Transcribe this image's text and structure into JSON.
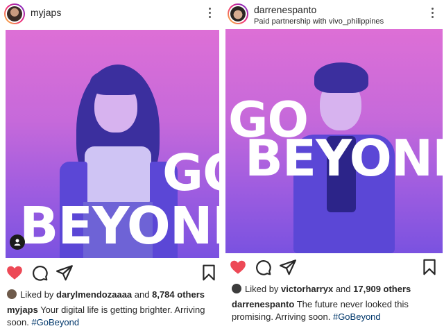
{
  "left_post": {
    "username": "myjaps",
    "image_text": {
      "go": "GO",
      "beyond": "BEYOND"
    },
    "likes": {
      "prefix": "Liked by",
      "user": "darylmendozaaaa",
      "middle": "and",
      "count": "8,784 others"
    },
    "caption": {
      "user": "myjaps",
      "text": "Your digital life is getting brighter. Arriving soon.",
      "hashtag": "#GoBeyond"
    }
  },
  "right_post": {
    "username": "darrenespanto",
    "sponsor": "Paid partnership with vivo_philippines",
    "image_text": {
      "go": "GO",
      "beyond": "BEYOND"
    },
    "likes": {
      "prefix": "Liked by",
      "user": "victorharryx",
      "middle": "and",
      "count": "17,909 others"
    },
    "caption": {
      "user": "darrenespanto",
      "text": "The future never looked this promising. Arriving soon.",
      "hashtag": "#GoBeyond"
    }
  },
  "colors": {
    "like": "#ed4956",
    "icon": "#262626",
    "hashtag": "#00376b",
    "bg_top": "#dd6fd6",
    "bg_bottom": "#7a52e0"
  },
  "icons": [
    "more-icon",
    "heart-icon",
    "comment-icon",
    "share-icon",
    "bookmark-icon",
    "user-tag-icon"
  ]
}
